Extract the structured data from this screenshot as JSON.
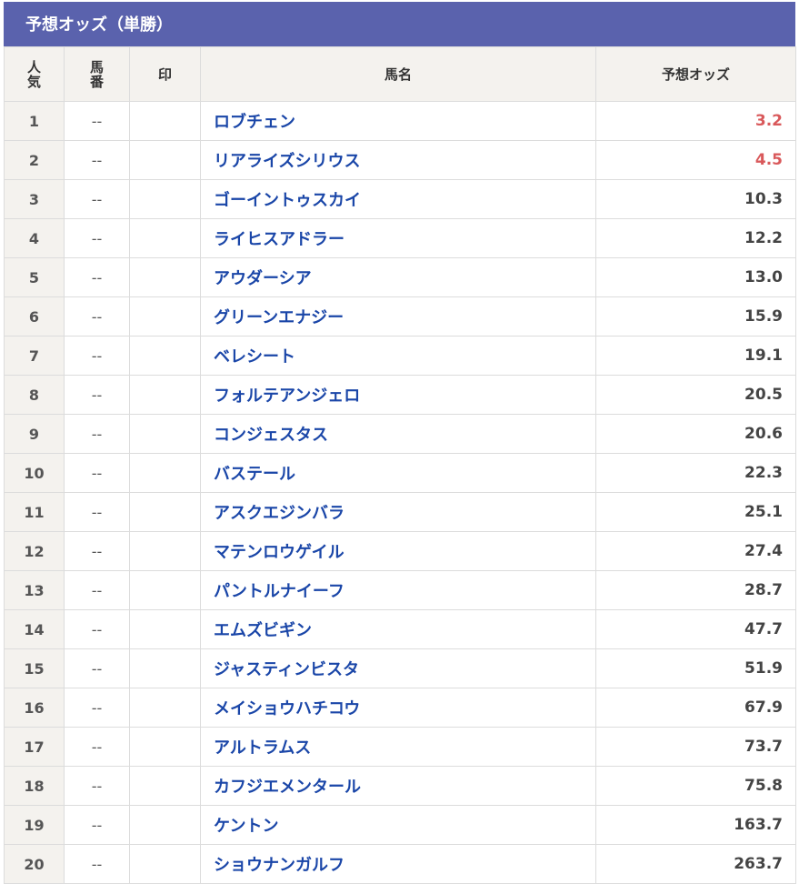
{
  "header": {
    "title": "予想オッズ（単勝）"
  },
  "columns": {
    "rank_top": "人",
    "rank_bottom": "気",
    "num_top": "馬",
    "num_bottom": "番",
    "mark": "印",
    "name": "馬名",
    "odds": "予想オッズ"
  },
  "colors": {
    "header_bg": "#5a62ad",
    "favorite_odds": "#d9595b",
    "horse_link": "#1a46a8"
  },
  "rows": [
    {
      "rank": "1",
      "num": "--",
      "mark": "",
      "name": "ロブチェン",
      "odds": "3.2",
      "hot": true
    },
    {
      "rank": "2",
      "num": "--",
      "mark": "",
      "name": "リアライズシリウス",
      "odds": "4.5",
      "hot": true
    },
    {
      "rank": "3",
      "num": "--",
      "mark": "",
      "name": "ゴーイントゥスカイ",
      "odds": "10.3",
      "hot": false
    },
    {
      "rank": "4",
      "num": "--",
      "mark": "",
      "name": "ライヒスアドラー",
      "odds": "12.2",
      "hot": false
    },
    {
      "rank": "5",
      "num": "--",
      "mark": "",
      "name": "アウダーシア",
      "odds": "13.0",
      "hot": false
    },
    {
      "rank": "6",
      "num": "--",
      "mark": "",
      "name": "グリーンエナジー",
      "odds": "15.9",
      "hot": false
    },
    {
      "rank": "7",
      "num": "--",
      "mark": "",
      "name": "ベレシート",
      "odds": "19.1",
      "hot": false
    },
    {
      "rank": "8",
      "num": "--",
      "mark": "",
      "name": "フォルテアンジェロ",
      "odds": "20.5",
      "hot": false
    },
    {
      "rank": "9",
      "num": "--",
      "mark": "",
      "name": "コンジェスタス",
      "odds": "20.6",
      "hot": false
    },
    {
      "rank": "10",
      "num": "--",
      "mark": "",
      "name": "バステール",
      "odds": "22.3",
      "hot": false
    },
    {
      "rank": "11",
      "num": "--",
      "mark": "",
      "name": "アスクエジンバラ",
      "odds": "25.1",
      "hot": false
    },
    {
      "rank": "12",
      "num": "--",
      "mark": "",
      "name": "マテンロウゲイル",
      "odds": "27.4",
      "hot": false
    },
    {
      "rank": "13",
      "num": "--",
      "mark": "",
      "name": "パントルナイーフ",
      "odds": "28.7",
      "hot": false
    },
    {
      "rank": "14",
      "num": "--",
      "mark": "",
      "name": "エムズビギン",
      "odds": "47.7",
      "hot": false
    },
    {
      "rank": "15",
      "num": "--",
      "mark": "",
      "name": "ジャスティンビスタ",
      "odds": "51.9",
      "hot": false
    },
    {
      "rank": "16",
      "num": "--",
      "mark": "",
      "name": "メイショウハチコウ",
      "odds": "67.9",
      "hot": false
    },
    {
      "rank": "17",
      "num": "--",
      "mark": "",
      "name": "アルトラムス",
      "odds": "73.7",
      "hot": false
    },
    {
      "rank": "18",
      "num": "--",
      "mark": "",
      "name": "カフジエメンタール",
      "odds": "75.8",
      "hot": false
    },
    {
      "rank": "19",
      "num": "--",
      "mark": "",
      "name": "ケントン",
      "odds": "163.7",
      "hot": false
    },
    {
      "rank": "20",
      "num": "--",
      "mark": "",
      "name": "ショウナンガルフ",
      "odds": "263.7",
      "hot": false
    }
  ]
}
